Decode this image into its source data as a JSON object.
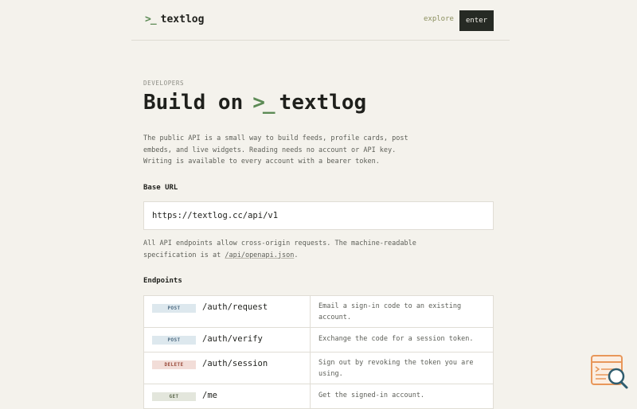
{
  "header": {
    "brand_icon": ">_",
    "brand": "textlog",
    "nav": {
      "explore": "explore",
      "enter": "enter"
    }
  },
  "page": {
    "eyebrow": "DEVELOPERS",
    "title_prefix": "Build on",
    "title_icon": ">_",
    "title_brand": "textlog",
    "intro": "The public API is a small way to build feeds, profile cards, post embeds, and live widgets. Reading needs no account or API key. Writing is available to every account with a bearer token."
  },
  "base_url": {
    "heading": "Base URL",
    "value": "https://textlog.cc/api/v1",
    "note_before": "All API endpoints allow cross-origin requests. The machine-readable specification is at ",
    "note_link": "/api/openapi.json",
    "note_after": "."
  },
  "endpoints": {
    "heading": "Endpoints",
    "rows": [
      {
        "method": "POST",
        "path": "/auth/request",
        "description": "Email a sign-in code to an existing account."
      },
      {
        "method": "POST",
        "path": "/auth/verify",
        "description": "Exchange the code for a session token."
      },
      {
        "method": "DELETE",
        "path": "/auth/session",
        "description": "Sign out by revoking the token you are using."
      },
      {
        "method": "GET",
        "path": "/me",
        "description": "Get the signed-in account."
      }
    ]
  },
  "colors": {
    "background": "#f4f2ec",
    "accent": "#5c8a55",
    "button_dark": "#262a24",
    "post_badge": "#dde8ee",
    "delete_badge": "#f2ddd8",
    "get_badge": "#e3e6dc"
  },
  "icons": {
    "brand": "terminal-prompt-icon",
    "floating_widget": "search-page-icon"
  }
}
